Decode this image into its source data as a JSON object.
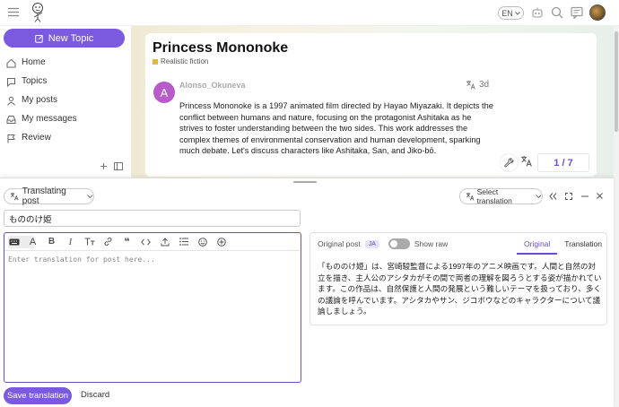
{
  "header": {
    "lang": "EN",
    "icons": [
      "menu-icon",
      "robot-icon",
      "search-icon",
      "chat-icon",
      "avatar"
    ]
  },
  "sidebar": {
    "new_topic": "New Topic",
    "items": [
      {
        "label": "Home",
        "icon": "home-icon"
      },
      {
        "label": "Topics",
        "icon": "topics-icon"
      },
      {
        "label": "My posts",
        "icon": "user-icon"
      },
      {
        "label": "My messages",
        "icon": "inbox-icon"
      },
      {
        "label": "Review",
        "icon": "flag-icon"
      }
    ]
  },
  "topic": {
    "title": "Princess Mononoke",
    "category": "Realistic fiction",
    "category_color": "#e2b93b",
    "author": "Alonso_Okuneva",
    "avatar_letter": "A",
    "avatar_color": "#b85ccc",
    "time": "3d",
    "body": "Princess Mononoke is a 1997 animated film directed by Hayao Miyazaki. It depicts the conflict between humans and nature, focusing on the protagonist Ashitaka as he strives to foster understanding between the two sides. This work addresses the complex themes of environmental conservation and human development, sparking much debate. Let's discuss characters like Ashitaka, San, and Jiko-bō.",
    "pager": "1 / 7"
  },
  "composer": {
    "mode": "Translating post",
    "select_translation": "Select translation",
    "title_value": "もののけ姫",
    "placeholder": "Enter translation for post here...",
    "preview": {
      "label": "Original post",
      "lang_badge": "JA",
      "show_raw": "Show raw",
      "tabs": [
        "Original",
        "Translation"
      ],
      "active_tab": "Original",
      "text": "「もののけ姫」は、宮崎駿監督による1997年のアニメ映画です。人間と自然の対立を描き、主人公のアシタカがその間で両者の理解を図ろうとする姿が描かれています。この作品は、自然保護と人間の発展という難しいテーマを扱っており、多くの議論を呼んでいます。アシタカやサン、ジコボウなどのキャラクターについて議論しましょう。"
    },
    "save": "Save translation",
    "discard": "Discard"
  },
  "colors": {
    "accent": "#7b5ae0",
    "link": "#6c4cd6"
  }
}
